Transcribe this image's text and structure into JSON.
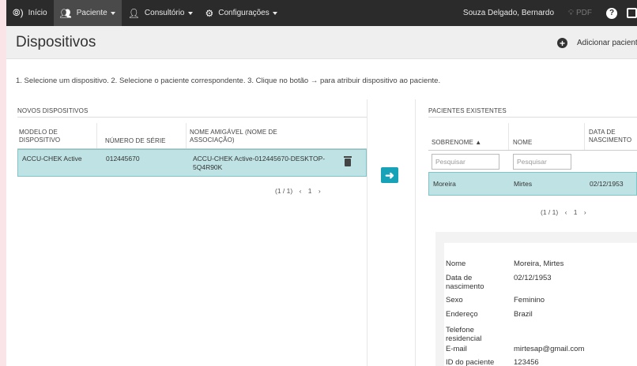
{
  "nav": {
    "home": "Início",
    "patient": "Paciente",
    "office": "Consultório",
    "settings": "Configurações",
    "user": "Souza Delgado, Bernardo",
    "pdf": "PDF",
    "help": "?"
  },
  "header": {
    "title": "Dispositivos",
    "add_patient": "Adicionar pacient"
  },
  "instructions": "1. Selecione um dispositivo. 2. Selecione o paciente correspondente. 3. Clique no botão → para atribuir dispositivo ao paciente.",
  "devices": {
    "title": "NOVOS DISPOSITIVOS",
    "columns": [
      "MODELO DE DISPOSITIVO",
      "NÚMERO DE SÉRIE",
      "NOME AMIGÁVEL (NOME DE ASSOCIAÇÃO)"
    ],
    "rows": [
      {
        "model": "ACCU-CHEK Active",
        "serial": "012445670",
        "friendly": "ACCU-CHEK Active-012445670-DESKTOP-5Q4R90K"
      }
    ],
    "pager": {
      "count": "(1 / 1)",
      "prev": "‹",
      "page": "1",
      "next": "›"
    }
  },
  "patients": {
    "title": "PACIENTES EXISTENTES",
    "columns": [
      "SOBRENOME ▲",
      "NOME",
      "DATA DE NASCIMENTO"
    ],
    "filter_placeholder": "Pesquisar",
    "rows": [
      {
        "surname": "Moreira",
        "name": "Mirtes",
        "dob": "02/12/1953"
      }
    ],
    "pager": {
      "count": "(1 / 1)",
      "prev": "‹",
      "page": "1",
      "next": "›"
    }
  },
  "detail": {
    "labels": [
      "Nome",
      "Data de nascimento",
      "Sexo",
      "Endereço",
      "Telefone residencial",
      "E-mail",
      "ID do paciente"
    ],
    "values": [
      "Moreira, Mirtes",
      "02/12/1953",
      "Feminino",
      "Brazil",
      "",
      "mirtesap@gmail.com",
      "123456"
    ]
  },
  "colors": {
    "accent": "#17a2b8",
    "selected_row": "#bfe3e4",
    "nav_bg": "#2b2b2b"
  }
}
